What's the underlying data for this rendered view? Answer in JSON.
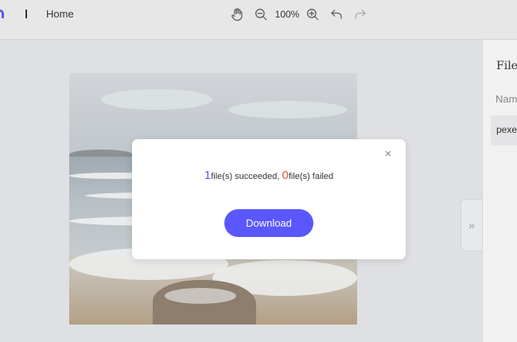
{
  "toolbar": {
    "home_label": "Home",
    "zoom_level": "100%",
    "tools": [
      "hand-icon",
      "zoom-out-icon",
      "zoom-in-icon",
      "undo-icon",
      "redo-icon"
    ]
  },
  "panel": {
    "title": "File",
    "column_header": "Nam",
    "rows": [
      "pexe"
    ],
    "collapse_glyph": "»"
  },
  "dialog": {
    "succeeded_count": "1",
    "succeeded_text": "file(s) succeeded, ",
    "failed_count": "0",
    "failed_text": "file(s) failed",
    "close_glyph": "×",
    "download_label": "Download"
  },
  "colors": {
    "accent": "#5a57ff",
    "failed": "#e0562d"
  }
}
